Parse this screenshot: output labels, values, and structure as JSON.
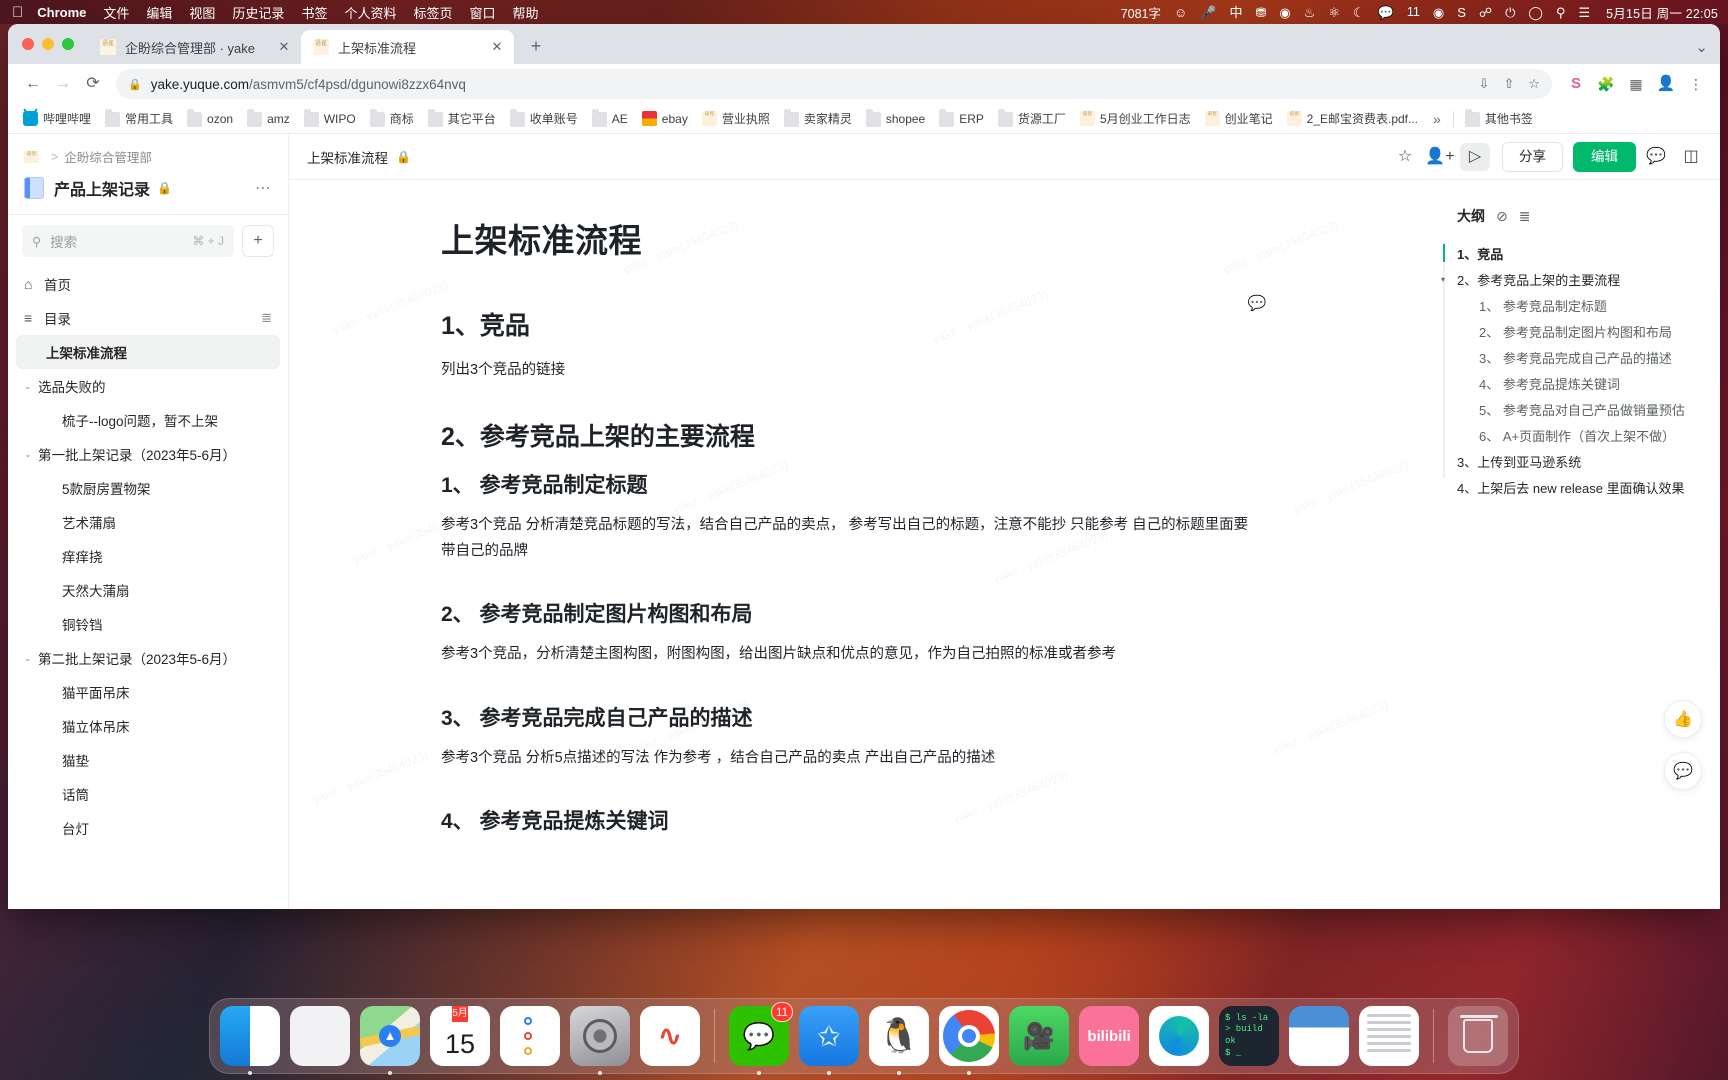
{
  "menubar": {
    "apple_icon": "apple-icon",
    "items": [
      "Chrome",
      "文件",
      "编辑",
      "视图",
      "历史记录",
      "书签",
      "个人资料",
      "标签页",
      "窗口",
      "帮助"
    ],
    "status": {
      "word_count": "7081字",
      "icons": [
        "smiley-icon",
        "microphone-icon",
        "input-method-icon",
        "robot-icon",
        "screen-record-icon",
        "droplet-icon",
        "app-icon",
        "moon-icon",
        "wechat-icon"
      ],
      "badge_count": "11",
      "more_icons": [
        "clock-icon",
        "s-app-icon",
        "bluetooth-icon",
        "battery-icon",
        "wifi-icon",
        "search-icon",
        "control-center-icon"
      ],
      "clock": "5月15日 周一  22:05"
    }
  },
  "browser": {
    "tabs": [
      {
        "title": "企盼综合管理部 · yake",
        "active": false,
        "favicon": "yuque-favicon"
      },
      {
        "title": "上架标准流程",
        "active": true,
        "favicon": "yuque-favicon"
      }
    ],
    "new_tab_label": "+",
    "nav": {
      "back": "←",
      "forward": "→",
      "reload": "⟳"
    },
    "omnibox": {
      "lock_icon": "lock-icon",
      "url_host": "yake.yuque.com",
      "url_path": "/asmvm5/cf4psd/dgunowi8zzx64nvq",
      "right_icons": [
        "download-icon",
        "share-icon",
        "bookmark-star-icon"
      ]
    },
    "toolbar_icons": [
      "extension-s-icon",
      "puzzle-extensions-icon",
      "sidepanel-icon",
      "profile-avatar-icon",
      "chrome-menu-icon"
    ],
    "bookmarks": [
      {
        "label": "哔哩哔哩",
        "icon": "bilibili-icon"
      },
      {
        "label": "常用工具",
        "icon": "folder-icon"
      },
      {
        "label": "ozon",
        "icon": "folder-icon"
      },
      {
        "label": "amz",
        "icon": "folder-icon"
      },
      {
        "label": "WIPO",
        "icon": "folder-icon"
      },
      {
        "label": "商标",
        "icon": "folder-icon"
      },
      {
        "label": "其它平台",
        "icon": "folder-icon"
      },
      {
        "label": "收单账号",
        "icon": "folder-icon"
      },
      {
        "label": "AE",
        "icon": "folder-icon"
      },
      {
        "label": "ebay",
        "icon": "ebay-icon"
      },
      {
        "label": "营业执照",
        "icon": "yuque-icon"
      },
      {
        "label": "卖家精灵",
        "icon": "folder-icon"
      },
      {
        "label": "shopee",
        "icon": "folder-icon"
      },
      {
        "label": "ERP",
        "icon": "folder-icon"
      },
      {
        "label": "货源工厂",
        "icon": "folder-icon"
      },
      {
        "label": "5月创业工作日志",
        "icon": "yuque-icon"
      },
      {
        "label": "创业笔记",
        "icon": "yuque-icon"
      },
      {
        "label": "2_E邮宝资费表.pdf...",
        "icon": "yuque-icon"
      }
    ],
    "bookmarks_overflow": "»",
    "other_bookmarks": {
      "label": "其他书签",
      "icon": "folder-icon"
    }
  },
  "sidebar": {
    "breadcrumb": {
      "logo": "yuque-logo",
      "separator": ">",
      "workspace": "企盼综合管理部"
    },
    "book": {
      "title": "产品上架记录",
      "lock_icon": "lock-icon",
      "more_icon": "more-dots-icon"
    },
    "search": {
      "placeholder": "搜索",
      "shortcut": "⌘ + J",
      "icon": "search-icon"
    },
    "add_button": "+",
    "nav": [
      {
        "label": "首页",
        "icon": "home-icon"
      },
      {
        "label": "目录",
        "icon": "toc-icon",
        "trailing_icon": "list-settings-icon"
      }
    ],
    "tree": [
      {
        "label": "上架标准流程",
        "level": "doc-top",
        "active": true
      },
      {
        "label": "选品失败的",
        "level": "lvl1",
        "caret": "⌄"
      },
      {
        "label": "梳子--logo问题，暂不上架",
        "level": "lvl2"
      },
      {
        "label": "第一批上架记录（2023年5-6月）",
        "level": "lvl1",
        "caret": "⌄"
      },
      {
        "label": "5款厨房置物架",
        "level": "lvl2"
      },
      {
        "label": "艺术蒲扇",
        "level": "lvl2"
      },
      {
        "label": "痒痒挠",
        "level": "lvl2"
      },
      {
        "label": "天然大蒲扇",
        "level": "lvl2"
      },
      {
        "label": "铜铃铛",
        "level": "lvl2"
      },
      {
        "label": "第二批上架记录（2023年5-6月）",
        "level": "lvl1",
        "caret": "⌄"
      },
      {
        "label": "猫平面吊床",
        "level": "lvl2"
      },
      {
        "label": "猫立体吊床",
        "level": "lvl2"
      },
      {
        "label": "猫垫",
        "level": "lvl2"
      },
      {
        "label": "话筒",
        "level": "lvl2"
      },
      {
        "label": "台灯",
        "level": "lvl2"
      }
    ]
  },
  "doc_header": {
    "title": "上架标准流程",
    "lock_icon": "lock-icon",
    "icons": [
      "star-icon",
      "add-member-icon",
      "present-mode-icon"
    ],
    "share_label": "分享",
    "edit_label": "编辑",
    "right_icons": [
      "comment-icon",
      "panel-toggle-icon"
    ]
  },
  "document": {
    "title": "上架标准流程",
    "comment_icon": "comment-bubble-icon",
    "watermark": "yake · yake(35464023)",
    "blocks": [
      {
        "type": "h2",
        "text": "1、竞品"
      },
      {
        "type": "p",
        "text": "列出3个竞品的链接"
      },
      {
        "type": "h2",
        "text": "2、参考竞品上架的主要流程"
      },
      {
        "type": "h3",
        "text": "1、 参考竞品制定标题"
      },
      {
        "type": "p",
        "text": "参考3个竞品 分析清楚竞品标题的写法，结合自己产品的卖点， 参考写出自己的标题，注意不能抄 只能参考 自己的标题里面要带自己的品牌"
      },
      {
        "type": "h3",
        "text": "2、 参考竞品制定图片构图和布局"
      },
      {
        "type": "p",
        "text": "参考3个竞品，分析清楚主图构图，附图构图，给出图片缺点和优点的意见，作为自己拍照的标准或者参考"
      },
      {
        "type": "h3",
        "text": "3、 参考竞品完成自己产品的描述"
      },
      {
        "type": "p",
        "text": "参考3个竞品 分析5点描述的写法 作为参考 ，结合自己产品的卖点 产出自己产品的描述"
      },
      {
        "type": "h3",
        "text": "4、 参考竞品提炼关键词"
      }
    ]
  },
  "outline": {
    "title": "大纲",
    "icons": [
      "hide-icon",
      "list-icon"
    ],
    "items": [
      {
        "label": "1、竞品",
        "level": "l1",
        "current": true
      },
      {
        "label": "2、参考竞品上架的主要流程",
        "level": "l1",
        "caret": "▾"
      },
      {
        "label": "1、 参考竞品制定标题",
        "level": "l2"
      },
      {
        "label": "2、 参考竞品制定图片构图和布局",
        "level": "l2"
      },
      {
        "label": "3、 参考竞品完成自己产品的描述",
        "level": "l2"
      },
      {
        "label": "4、 参考竞品提炼关键词",
        "level": "l2"
      },
      {
        "label": "5、 参考竞品对自己产品做销量预估",
        "level": "l2"
      },
      {
        "label": "6、 A+页面制作（首次上架不做）",
        "level": "l2"
      },
      {
        "label": "3、上传到亚马逊系统",
        "level": "l1"
      },
      {
        "label": "4、上架后去 new release 里面确认效果",
        "level": "l1"
      }
    ]
  },
  "float_buttons": [
    {
      "icon": "thumbs-up-icon"
    },
    {
      "icon": "comment-icon"
    }
  ],
  "dock": {
    "apps": [
      {
        "name": "finder",
        "badge": null,
        "running": true
      },
      {
        "name": "launchpad",
        "badge": null,
        "running": false
      },
      {
        "name": "maps",
        "badge": null,
        "running": false
      },
      {
        "name": "calendar",
        "badge": null,
        "running": true,
        "month": "5月",
        "day": "15"
      },
      {
        "name": "reminders",
        "badge": null,
        "running": false
      },
      {
        "name": "system-settings",
        "badge": null,
        "running": true
      },
      {
        "name": "app-music",
        "badge": null,
        "running": false
      },
      {
        "name": "wechat",
        "badge": "11",
        "running": true
      },
      {
        "name": "dingtalk",
        "badge": null,
        "running": true
      },
      {
        "name": "qq",
        "badge": null,
        "running": true
      },
      {
        "name": "chrome",
        "badge": null,
        "running": true
      },
      {
        "name": "facetime",
        "badge": null,
        "running": false
      },
      {
        "name": "bilibili",
        "badge": null,
        "running": false
      },
      {
        "name": "edge",
        "badge": null,
        "running": false
      },
      {
        "name": "terminal",
        "badge": null,
        "running": false
      },
      {
        "name": "preview-window-1",
        "badge": null,
        "running": false
      },
      {
        "name": "preview-window-2",
        "badge": null,
        "running": false
      },
      {
        "name": "trash",
        "badge": null,
        "running": false
      }
    ]
  },
  "colors": {
    "accent_green": "#00b96b",
    "chrome_tabbar": "#dee1e6",
    "badge_red": "#ff3b30"
  }
}
